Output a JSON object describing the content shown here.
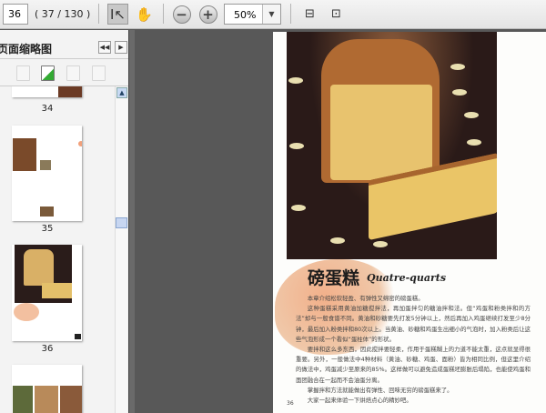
{
  "toolbar": {
    "current_page": "36",
    "page_count": "( 37 / 130 )",
    "zoom": "50%"
  },
  "sidebar": {
    "title": "页面缩略图",
    "thumbnails": [
      {
        "label": "34"
      },
      {
        "label": "35"
      },
      {
        "label": "36"
      }
    ]
  },
  "document": {
    "title": "磅蛋糕",
    "subtitle": "Quatre-quarts",
    "page_number": "36",
    "paragraphs": [
      "本章介绍松软轻盈、有弹性又绵密的磅蛋糕。",
      "这种蛋糕采用黄油加糖搅拌法，再加蛋拌匀的糖油拌和法。但“鸡蛋和粉类拌和的方法”却与一般食谱不同。黄油和砂糖要先打发5分钟以上，然后再加入鸡蛋继续打发至少8分钟，最后加入粉类拌和80次以上。当黄油、砂糖和鸡蛋生出细小的气泡时，加入粉类后让这些气泡形成一个看似“蛋柱体”的形状。",
      "要拌和这么多东西，因此搅拌要轻柔，作用于蛋糕糊上的力道不能太重，这点就显得很重要。另外，一般做法中4种材料（黄油、砂糖、鸡蛋、面粉）皆为相同比例，但这里介绍的做法中，鸡蛋减少至原来的85%。这样做可以避免造成蛋糕坯膨胀后塌陷，也能使鸡蛋和面团融合在一起而不会油蛋分离。",
      "掌握拌和方法就能做出有弹性、回味无穷的磅蛋糕来了。",
      "大家一起来体验一下烘焙点心的精妙吧。"
    ]
  }
}
